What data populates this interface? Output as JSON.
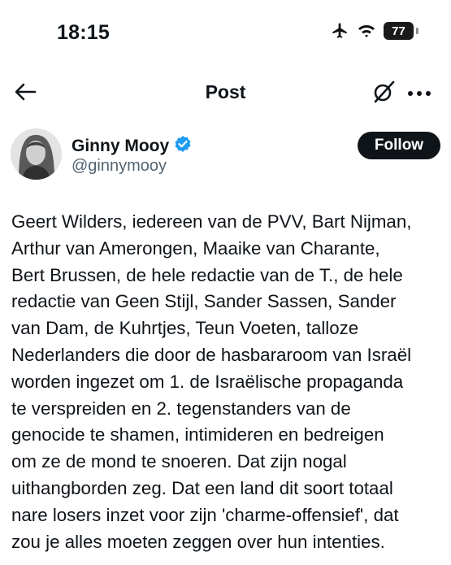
{
  "status_bar": {
    "time": "18:15",
    "battery": "77",
    "icons": [
      "airplane-icon",
      "wifi-icon",
      "battery-icon"
    ]
  },
  "nav": {
    "title": "Post",
    "icons": [
      "back-arrow-icon",
      "grok-icon",
      "more-icon"
    ]
  },
  "author": {
    "display_name": "Ginny Mooy",
    "handle": "@ginnymooy",
    "follow_label": "Follow",
    "verified_color": "#1d9bf0"
  },
  "post": {
    "lines": [
      "Geert Wilders, iedereen van de PVV, Bart Nijman,",
      "Arthur van Amerongen, Maaike van Charante,",
      "Bert Brussen, de hele redactie van de T., de hele",
      "redactie van Geen Stijl, Sander Sassen, Sander",
      "van Dam, de Kuhrtjes, Teun Voeten, talloze",
      "Nederlanders die door de hasbararoom van Israël",
      "worden ingezet om 1. de Israëlische propaganda",
      "te verspreiden en 2. tegenstanders van de",
      "genocide te shamen, intimideren en bedreigen",
      "om ze de mond te snoeren. Dat zijn nogal",
      "uithangborden zeg. Dat een land dit soort totaal",
      "nare losers inzet voor zijn 'charme-offensief', dat",
      "zou je alles moeten zeggen over hun intenties."
    ]
  }
}
